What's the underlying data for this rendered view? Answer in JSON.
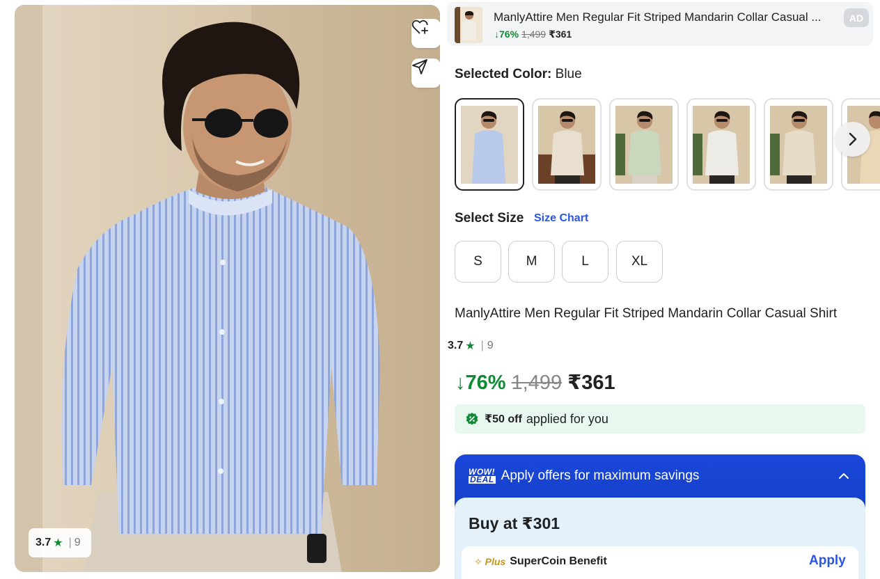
{
  "product_image": {
    "rating": "3.7",
    "rating_count": "9",
    "wishlist_icon": "heart-plus-icon",
    "share_icon": "send-icon"
  },
  "ad_banner": {
    "title": "ManlyAttire Men Regular Fit Striped Mandarin Collar Casual ...",
    "discount": "↓76%",
    "mrp": "1,499",
    "price": "₹361",
    "badge": "AD"
  },
  "color_selector": {
    "label": "Selected Color:",
    "value": "Blue",
    "swatches": [
      {
        "color": "Blue",
        "shirt": "#b8c9ea"
      },
      {
        "color": "Beige",
        "shirt": "#e8dfcf"
      },
      {
        "color": "Sage",
        "shirt": "#c9d7bd"
      },
      {
        "color": "Off-White",
        "shirt": "#ecebe6"
      },
      {
        "color": "Cream",
        "shirt": "#e6dcc8"
      },
      {
        "color": "Sand",
        "shirt": "#e9d7b6"
      }
    ],
    "next_icon": "chevron-right-icon"
  },
  "size_selector": {
    "label": "Select Size",
    "chart_link": "Size Chart",
    "sizes": [
      "S",
      "M",
      "L",
      "XL"
    ]
  },
  "product": {
    "title": "ManlyAttire Men Regular Fit Striped Mandarin Collar Casual Shirt",
    "rating": "3.7",
    "rating_count": "9",
    "discount": "↓76%",
    "mrp": "1,499",
    "price": "₹361"
  },
  "applied_offer": {
    "amount": "₹50 off",
    "text": "applied for you"
  },
  "offers_panel": {
    "badge_line1": "WOW!",
    "badge_line2": "DEAL",
    "heading": "Apply offers for maximum savings",
    "buy_at": "Buy at ₹301",
    "supercoin_plus": "Plus",
    "supercoin_label": "SuperCoin Benefit",
    "apply_label": "Apply"
  },
  "colors": {
    "green": "#108934",
    "blue_link": "#2a55e5",
    "offer_blue": "#1a47d8"
  }
}
